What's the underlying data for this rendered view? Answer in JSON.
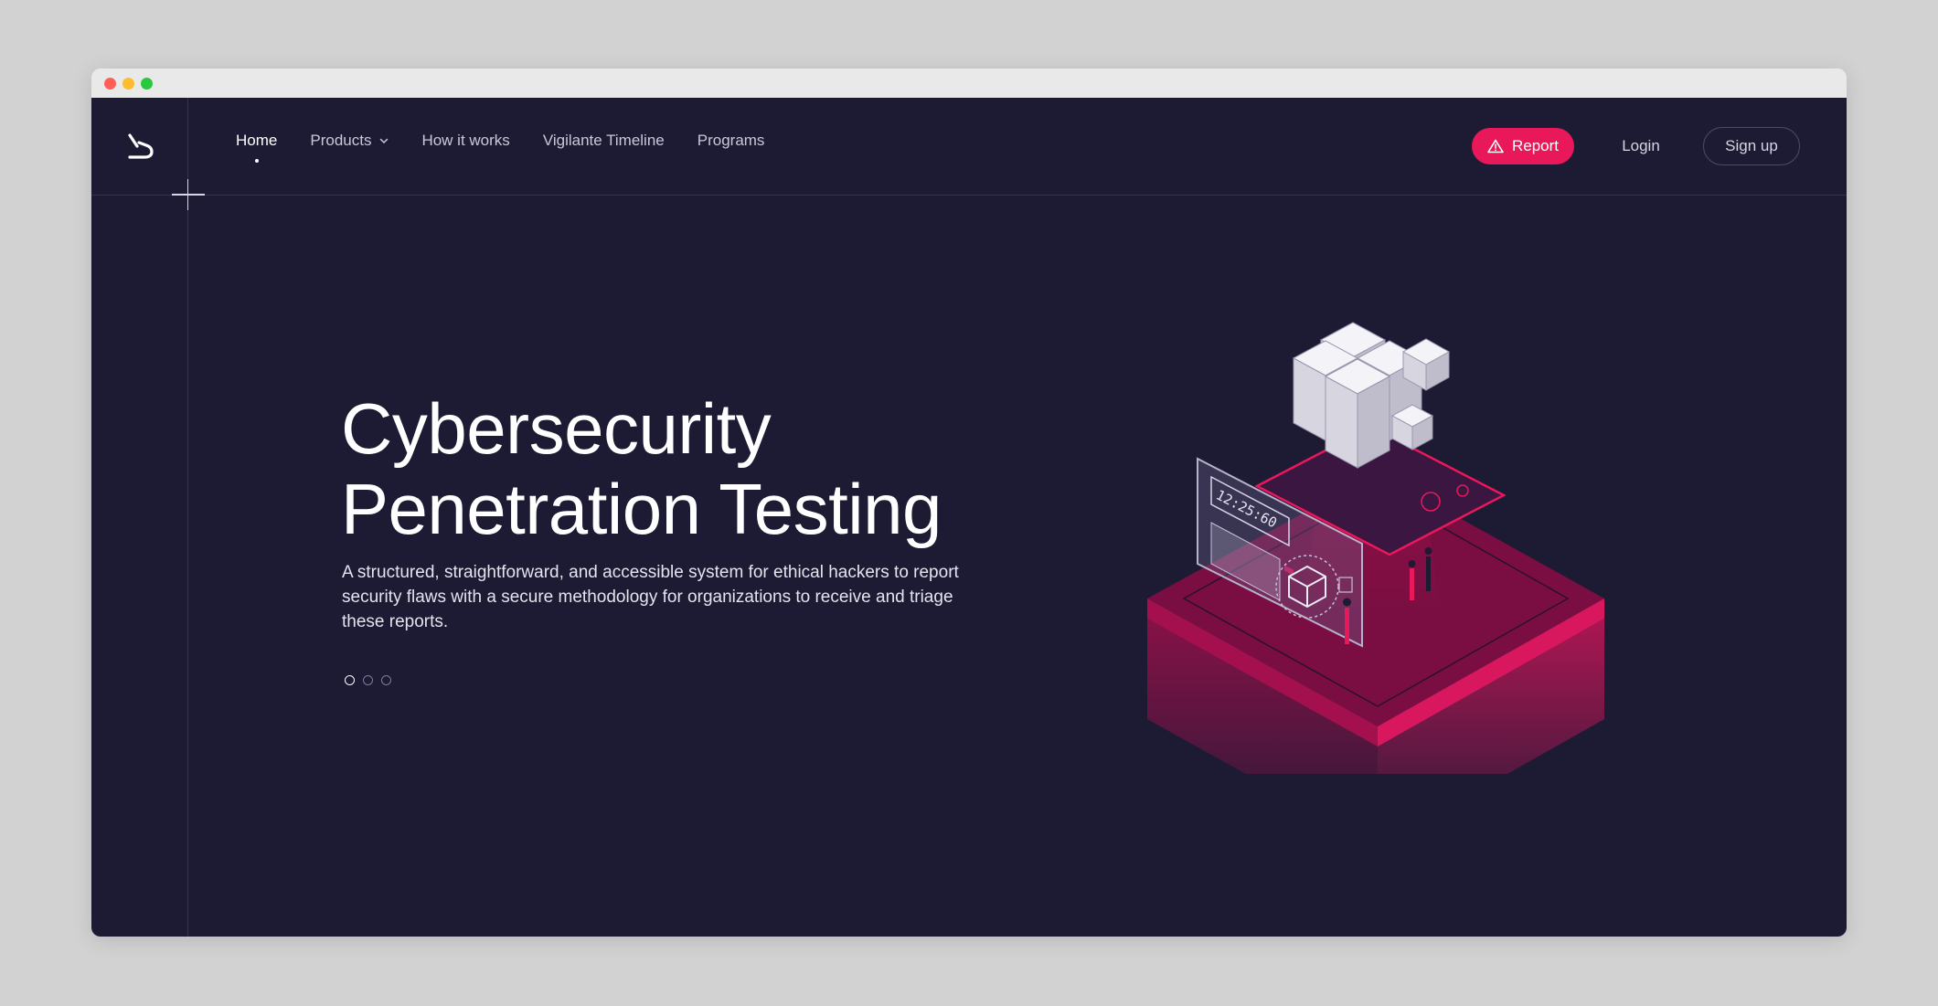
{
  "nav": {
    "items": [
      {
        "label": "Home",
        "active": true
      },
      {
        "label": "Products",
        "has_dropdown": true
      },
      {
        "label": "How it works"
      },
      {
        "label": "Vigilante Timeline"
      },
      {
        "label": "Programs"
      }
    ]
  },
  "actions": {
    "report_label": "Report",
    "login_label": "Login",
    "signup_label": "Sign up"
  },
  "hero": {
    "title_line1": "Cybersecurity",
    "title_line2": "Penetration Testing",
    "description": "A structured, straightforward, and accessible system for ethical hackers to report security flaws with a secure methodology for organizations to receive and triage these reports.",
    "slides_total": 3,
    "slide_active": 1
  },
  "illustration": {
    "timer": "12:25:60"
  },
  "icons": {
    "logo": "logo-icon",
    "dropdown": "chevron-down-icon",
    "report": "warning-triangle-icon"
  },
  "colors": {
    "background": "#1d1b34",
    "accent": "#e8185a",
    "text": "#ffffff"
  }
}
